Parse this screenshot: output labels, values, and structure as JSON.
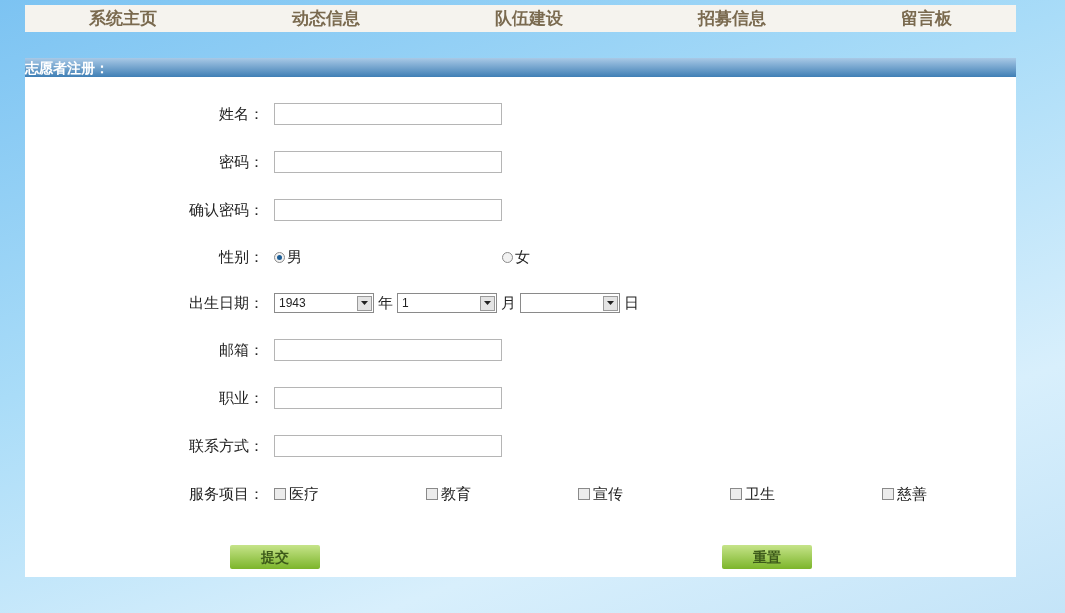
{
  "nav": [
    {
      "label": "系统主页"
    },
    {
      "label": "动态信息"
    },
    {
      "label": "队伍建设"
    },
    {
      "label": "招募信息"
    },
    {
      "label": "留言板"
    }
  ],
  "section_title": "志愿者注册：",
  "form": [
    {
      "kind": "text",
      "label": "姓名："
    },
    {
      "kind": "password",
      "label": "密码："
    },
    {
      "kind": "password",
      "label": "确认密码："
    },
    {
      "kind": "radio",
      "label": "性别：",
      "options": [
        {
          "label": "男",
          "selected": true
        },
        {
          "label": "女",
          "selected": false
        }
      ]
    },
    {
      "kind": "date",
      "label": "出生日期：",
      "parts": [
        {
          "value": "1943",
          "unit": "年"
        },
        {
          "value": "1",
          "unit": "月"
        },
        {
          "unit": "日"
        }
      ]
    },
    {
      "kind": "text",
      "label": "邮箱："
    },
    {
      "kind": "text",
      "label": "职业："
    },
    {
      "kind": "text",
      "label": "联系方式："
    },
    {
      "kind": "checkbox",
      "label": "服务项目：",
      "options": [
        {
          "label": "医疗",
          "checked": false
        },
        {
          "label": "教育",
          "checked": false
        },
        {
          "label": "宣传",
          "checked": false
        },
        {
          "label": "卫生",
          "checked": false
        },
        {
          "label": "慈善",
          "checked": false
        }
      ]
    }
  ],
  "buttons": [
    {
      "label": "提交"
    },
    {
      "label": "重置"
    }
  ]
}
